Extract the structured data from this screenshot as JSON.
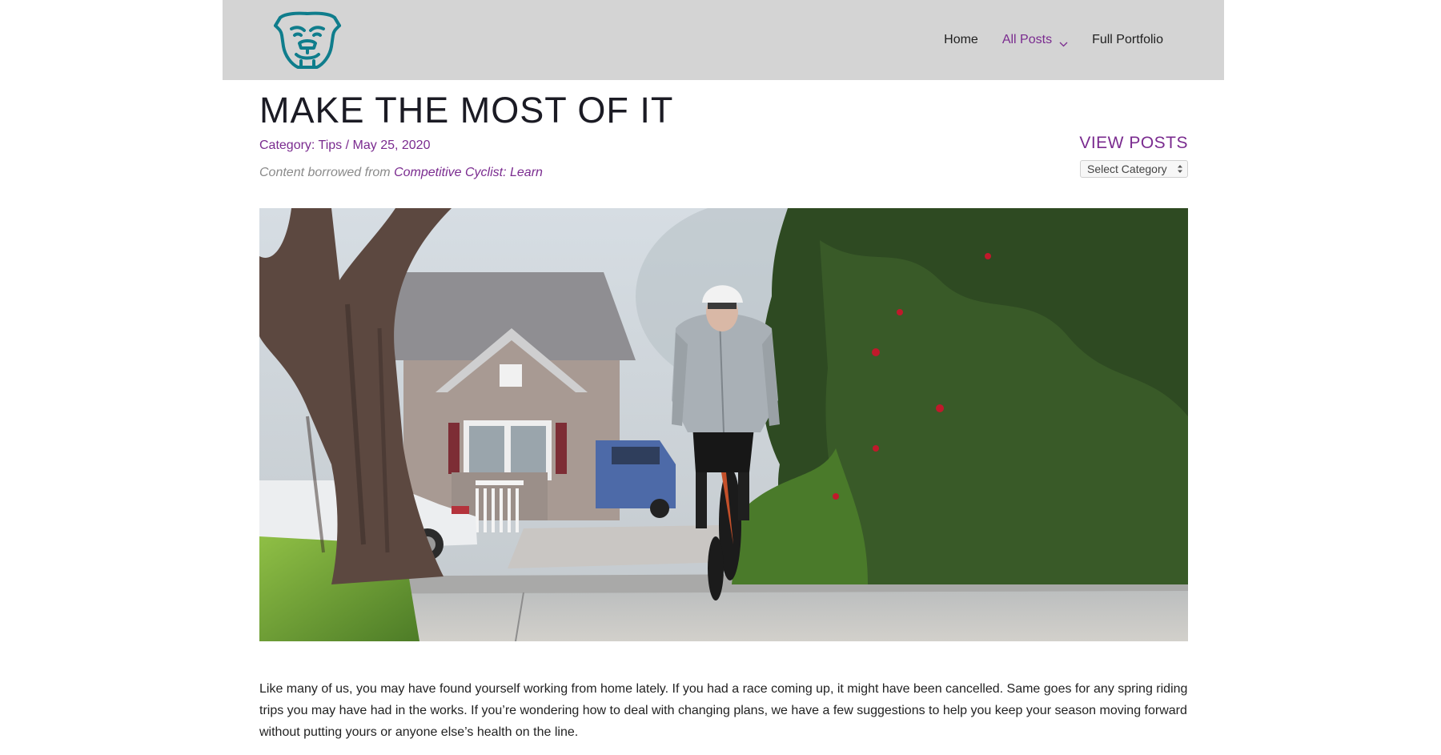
{
  "header": {
    "logo_icon": "bulldog-logo-icon",
    "nav": [
      {
        "label": "Home",
        "active": false
      },
      {
        "label": "All Posts",
        "active": true,
        "has_dropdown": true
      },
      {
        "label": "Full Portfolio",
        "active": false
      }
    ]
  },
  "post": {
    "title": "MAKE THE MOST OF IT",
    "meta_prefix": "Category: ",
    "category": "Tips",
    "meta_separator": " / ",
    "date": "May 25, 2020",
    "credit_prefix": "Content borrowed from ",
    "credit_link": "Competitive Cyclist: Learn",
    "image_icon": "cyclist-photo",
    "body": "Like many of us, you may have found yourself working from home lately. If you had a race coming up, it might have been cancelled. Same goes for any spring riding trips you may have had in the works. If you’re wondering how to deal with changing plans, we have a few suggestions to help you keep your season moving forward without putting yours or anyone else’s health on the line."
  },
  "sidebar": {
    "title": "VIEW POSTS",
    "select_value": "Select Category"
  },
  "colors": {
    "accent": "#7a2b8f",
    "header_bg": "#d4d4d4",
    "logo_teal": "#0f7d8c"
  }
}
